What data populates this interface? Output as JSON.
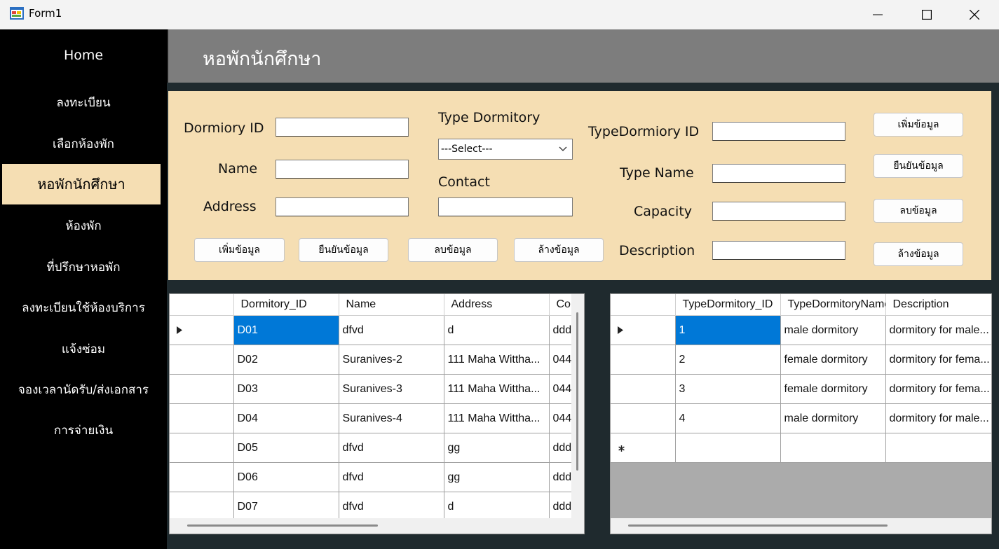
{
  "window": {
    "title": "Form1"
  },
  "sidebar": {
    "items": [
      {
        "label": "Home"
      },
      {
        "label": "ลงทะเบียน"
      },
      {
        "label": "เลือกห้องพัก"
      },
      {
        "label": "หอพักนักศึกษา"
      },
      {
        "label": "ห้องพัก"
      },
      {
        "label": "ที่ปรึกษาหอพัก"
      },
      {
        "label": "ลงทะเบียนใช้ห้องบริการ"
      },
      {
        "label": "แจ้งซ่อม"
      },
      {
        "label": "จองเวลานัดรับ/ส่งเอกสาร"
      },
      {
        "label": "การจ่ายเงิน"
      }
    ],
    "active_index": 3
  },
  "header": {
    "title": "หอพักนักศึกษา"
  },
  "form": {
    "labels": {
      "dormitory_id": "Dormiory ID",
      "name": "Name",
      "address": "Address",
      "type_dormitory": "Type Dormitory",
      "contact": "Contact",
      "type_dormitory_id": "TypeDormiory ID",
      "type_name": "Type Name",
      "capacity": "Capacity",
      "description": "Description"
    },
    "values": {
      "dormitory_id": "",
      "name": "",
      "address": "",
      "contact": "",
      "type_dormitory_id": "",
      "type_name": "",
      "capacity": "",
      "description": ""
    },
    "type_dormitory_select": "---Select---",
    "dorm_buttons": {
      "add": "เพิ่มข้อมูล",
      "confirm": "ยืนยันข้อมูล",
      "delete": "ลบข้อมูล",
      "clear": "ล้างข้อมูล"
    },
    "type_buttons": {
      "add": "เพิ่มข้อมูล",
      "confirm": "ยืนยันข้อมูล",
      "delete": "ลบข้อมูล",
      "clear": "ล้างข้อมูล"
    }
  },
  "dorm_grid": {
    "columns": [
      "Dormitory_ID",
      "Name",
      "Address",
      "Co"
    ],
    "rows": [
      [
        "D01",
        "dfvd",
        "d",
        "ddd"
      ],
      [
        "D02",
        "Suranives-2",
        "111 Maha Wittha...",
        "044"
      ],
      [
        "D03",
        "Suranives-3",
        "111 Maha Wittha...",
        "044"
      ],
      [
        "D04",
        "Suranives-4",
        "111 Maha Wittha...",
        "044"
      ],
      [
        "D05",
        "dfvd",
        "gg",
        "ddd"
      ],
      [
        "D06",
        "dfvd",
        "gg",
        "ddd"
      ],
      [
        "D07",
        "dfvd",
        "d",
        "ddd"
      ]
    ]
  },
  "type_grid": {
    "columns": [
      "TypeDormitory_ID",
      "TypeDormitoryName",
      "Description"
    ],
    "rows": [
      [
        "1",
        "male dormitory",
        "dormitory for male..."
      ],
      [
        "2",
        "female dormitory",
        "dormitory for fema..."
      ],
      [
        "3",
        "female dormitory",
        "dormitory for fema..."
      ],
      [
        "4",
        "male dormitory",
        "dormitory for male..."
      ]
    ]
  },
  "icons": {
    "row_pointer": "triangle-right-icon",
    "new_row": "asterisk-icon"
  },
  "colors": {
    "accent": "#f5deb3",
    "selection": "#0078d7",
    "header": "#7d7d7d"
  }
}
